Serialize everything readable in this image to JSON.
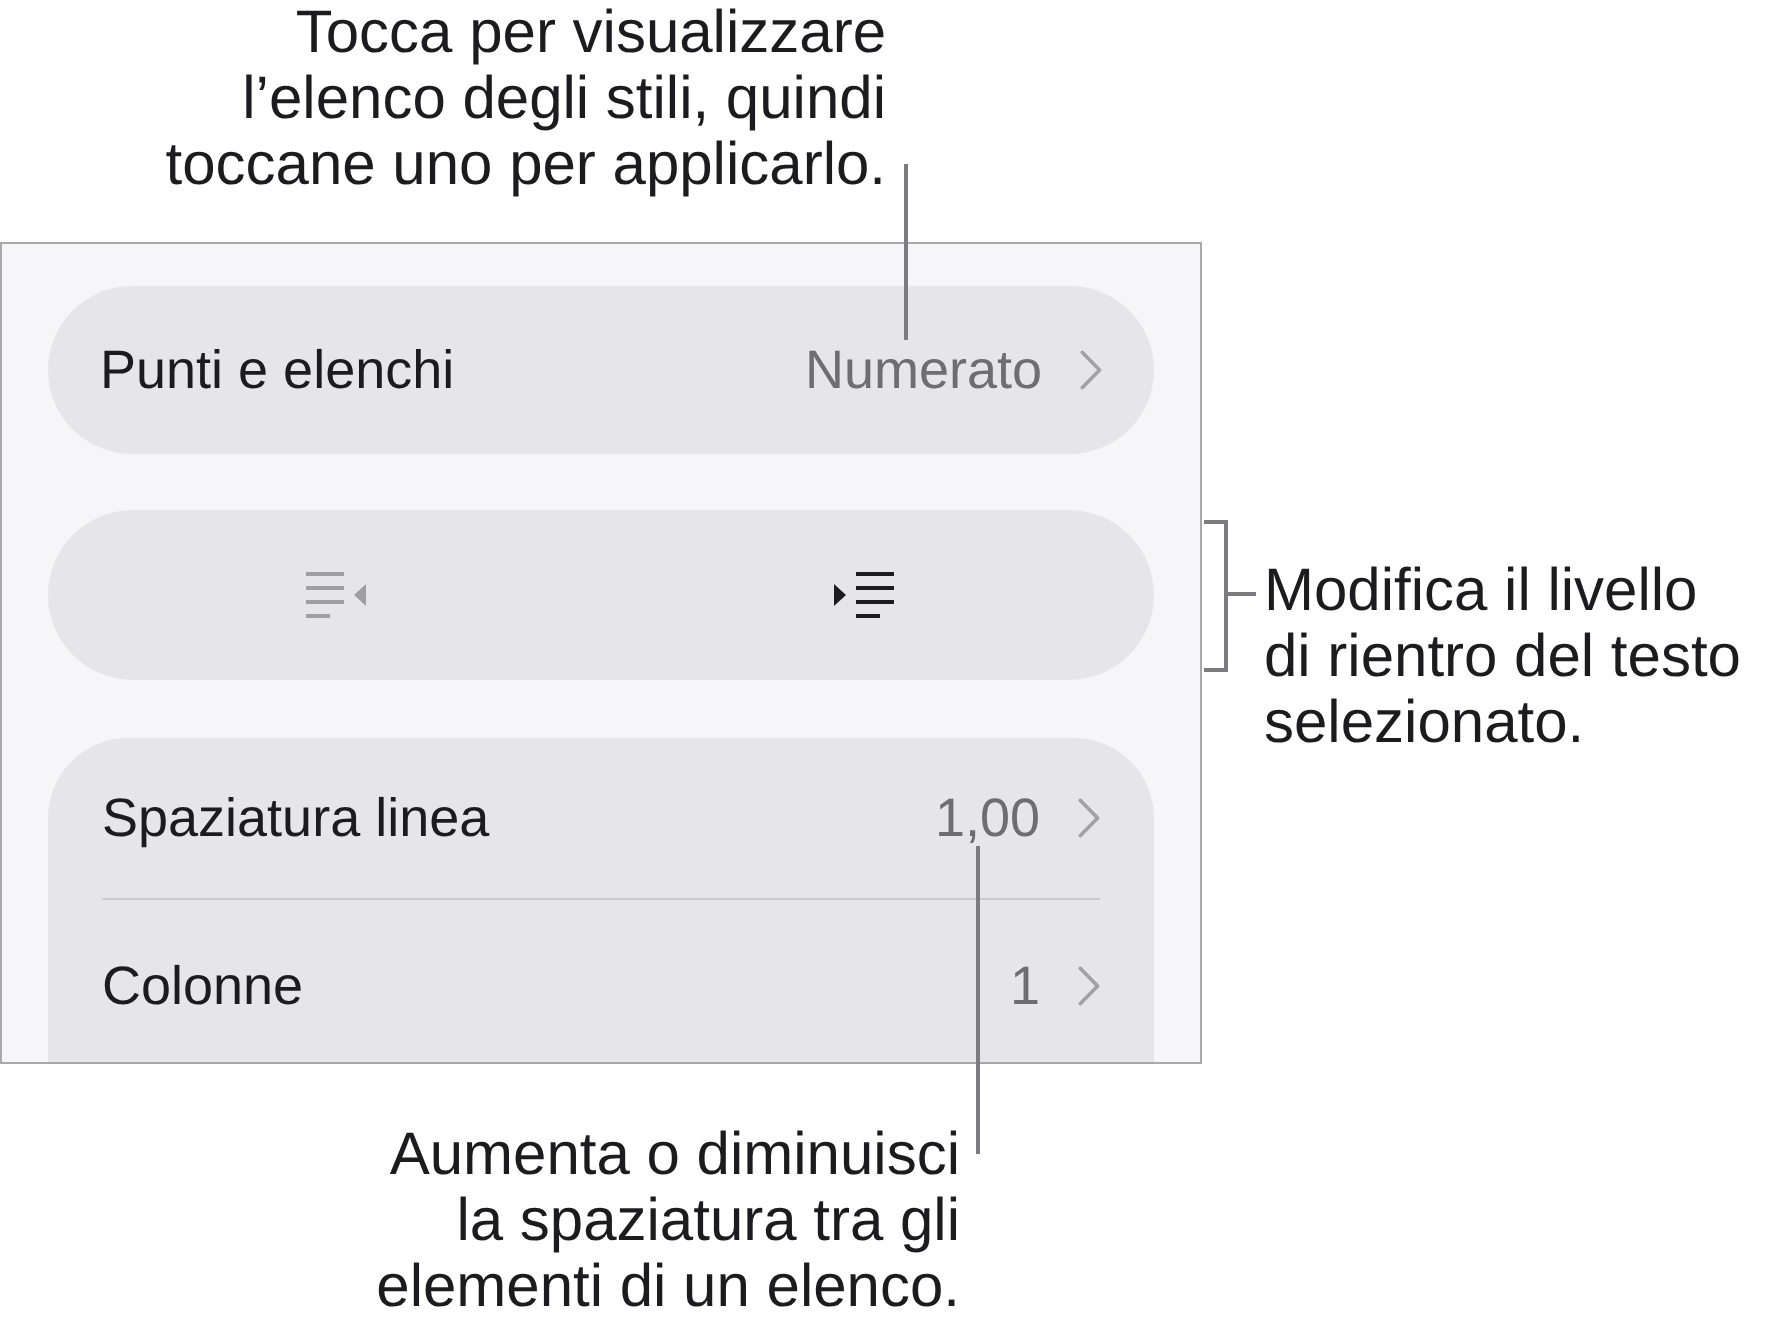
{
  "callouts": [
    {
      "kind": "top",
      "lines": [
        "Tocca per visualizzare",
        "l’elenco degli stili, quindi",
        "toccane uno per applicarlo."
      ]
    },
    {
      "kind": "right",
      "lines": [
        "Modifica il livello",
        "di rientro del testo",
        "selezionato."
      ]
    },
    {
      "kind": "bottom",
      "lines": [
        "Aumenta o diminuisci",
        "la spaziatura tra gli",
        "elementi di un elenco."
      ]
    }
  ],
  "panel": {
    "list_style": {
      "label": "Punti e elenchi",
      "value": "Numerato"
    },
    "indent_buttons": [
      {
        "kind": "outdent",
        "disabled": true
      },
      {
        "kind": "indent",
        "disabled": false
      }
    ],
    "settings_group": [
      {
        "label": "Spaziatura linea",
        "value": "1,00"
      },
      {
        "label": "Colonne",
        "value": "1"
      }
    ]
  }
}
